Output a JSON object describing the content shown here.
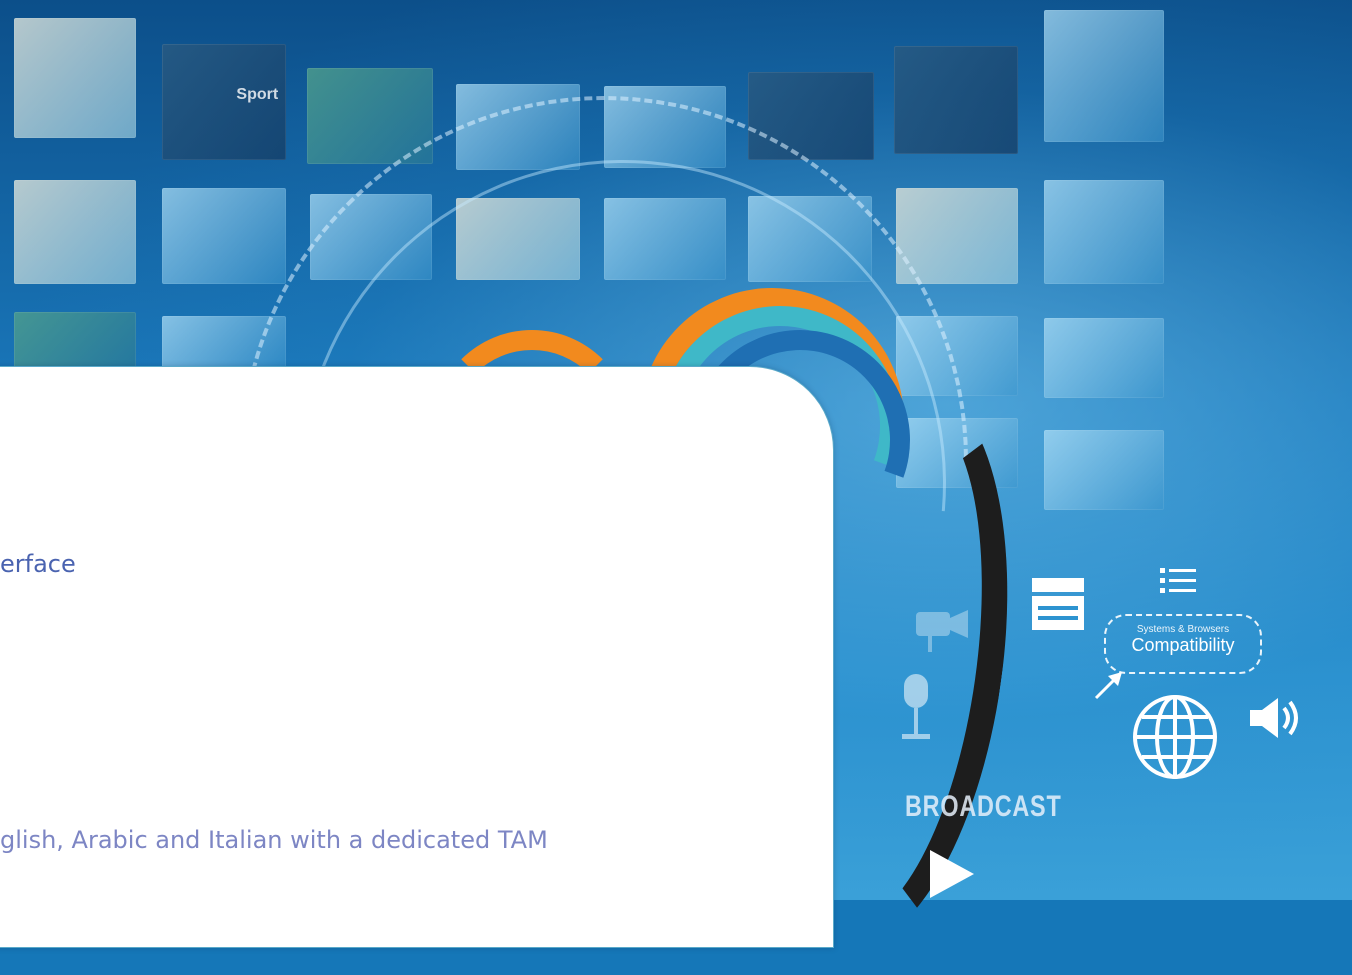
{
  "hero": {
    "tile_label": "Sport",
    "compatibility_small": "Systems & Browsers",
    "compatibility_big": "Compatibility",
    "broadcast_label": "BROADCAST"
  },
  "panel": {
    "heading_fragment": "erface",
    "text_fragment": "glish, Arabic and Italian with a dedicated TAM"
  },
  "icons": [
    "camera-icon",
    "microphone-icon",
    "clapperboard-icon",
    "list-icon",
    "globe-icon",
    "speaker-icon",
    "play-icon",
    "arrow-icon"
  ],
  "colors": {
    "background": "#1577b8",
    "panel": "#ffffff",
    "heading": "#4a63b0",
    "body_text": "#7d86c4"
  }
}
